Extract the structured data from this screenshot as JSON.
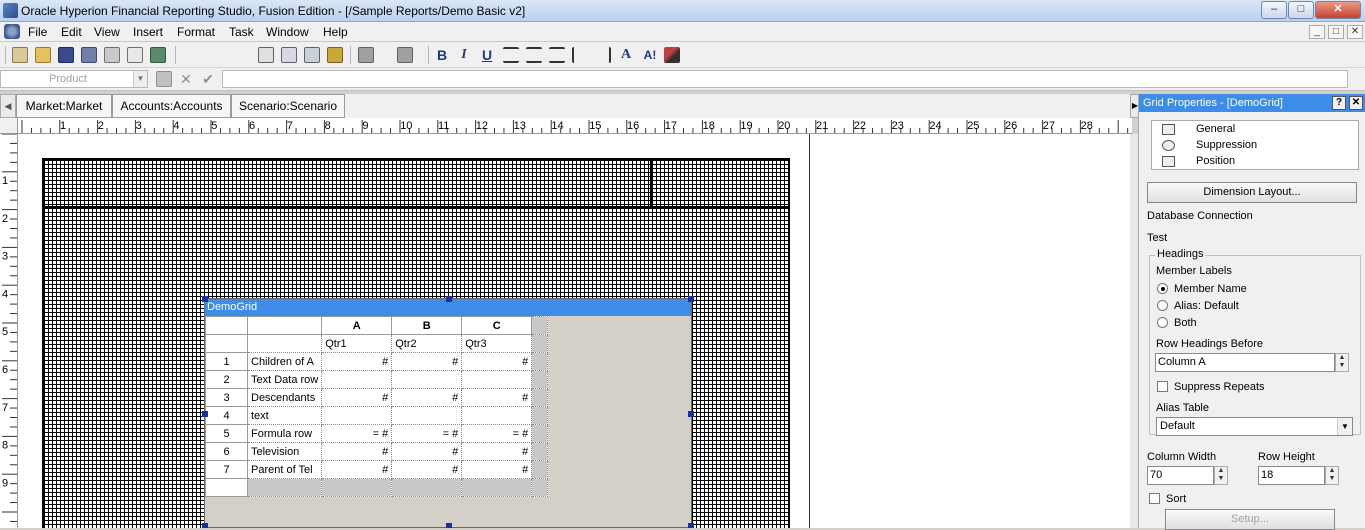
{
  "window": {
    "title": "Oracle Hyperion Financial Reporting Studio, Fusion Edition - [/Sample Reports/Demo Basic v2]",
    "min_label": "–",
    "max_label": "□",
    "close_label": "✕"
  },
  "menu": {
    "items": [
      "File",
      "Edit",
      "View",
      "Insert",
      "Format",
      "Task",
      "Window",
      "Help"
    ],
    "mdi_min": "_",
    "mdi_restore": "□",
    "mdi_close": "✕"
  },
  "toolbar": {
    "bold": "B",
    "italic": "I",
    "underline": "U",
    "font_up": "A",
    "font_down": "A!"
  },
  "formula_bar": {
    "dimension_value": "Product",
    "formula_value": ""
  },
  "pov": {
    "tabs": [
      "Market:Market",
      "Accounts:Accounts",
      "Scenario:Scenario"
    ]
  },
  "ruler": {
    "h_labels": [
      "1",
      "2",
      "3",
      "4",
      "5",
      "6",
      "7",
      "8",
      "9",
      "10",
      "11",
      "12",
      "13",
      "14",
      "15",
      "16",
      "17",
      "18",
      "19",
      "20",
      "21",
      "22",
      "23",
      "24",
      "25",
      "26",
      "27",
      "28"
    ],
    "v_labels": [
      "1",
      "2",
      "3",
      "4",
      "5",
      "6",
      "7",
      "8",
      "9"
    ]
  },
  "grid": {
    "name": "DemoGrid",
    "col_headers": [
      "A",
      "B",
      "C"
    ],
    "col_members": [
      "Qtr1",
      "Qtr2",
      "Qtr3"
    ],
    "rows": [
      {
        "num": "1",
        "label": "Children of A",
        "cells": [
          "#",
          "#",
          "#"
        ]
      },
      {
        "num": "2",
        "label": "Text Data row",
        "cells": [
          "",
          "",
          ""
        ]
      },
      {
        "num": "3",
        "label": "Descendants",
        "cells": [
          "#",
          "#",
          "#"
        ]
      },
      {
        "num": "4",
        "label": "text",
        "cells": [
          "",
          "",
          ""
        ]
      },
      {
        "num": "5",
        "label": "Formula row",
        "cells": [
          "= #",
          "= #",
          "= #"
        ]
      },
      {
        "num": "6",
        "label": "Television",
        "cells": [
          "#",
          "#",
          "#"
        ]
      },
      {
        "num": "7",
        "label": "Parent of Tel",
        "cells": [
          "#",
          "#",
          "#"
        ]
      }
    ]
  },
  "properties": {
    "title": "Grid Properties - [DemoGrid]",
    "help_label": "?",
    "close_label": "✕",
    "tree": [
      "General",
      "Suppression",
      "Position"
    ],
    "dimension_layout_button": "Dimension Layout...",
    "db_connection_label": "Database Connection",
    "db_connection_value": "Test",
    "headings_label": "Headings",
    "member_labels_label": "Member Labels",
    "radio_options": [
      "Member Name",
      "Alias: Default",
      "Both"
    ],
    "selected_option": "Member Name",
    "row_headings_before_label": "Row Headings Before",
    "row_headings_before_value": "Column A",
    "suppress_repeats_label": "Suppress Repeats",
    "alias_table_label": "Alias Table",
    "alias_table_value": "Default",
    "column_width_label": "Column Width",
    "column_width_value": "70",
    "row_height_label": "Row Height",
    "row_height_value": "18",
    "sort_label": "Sort",
    "setup_button": "Setup..."
  }
}
